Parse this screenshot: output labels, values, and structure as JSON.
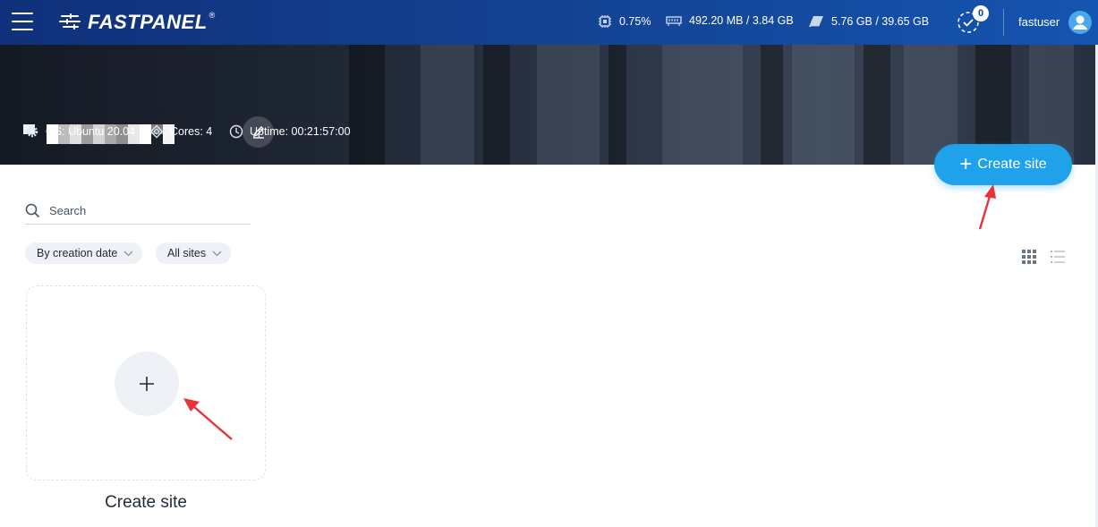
{
  "header": {
    "app_name": "FASTPANEL",
    "reg_mark": "®",
    "cpu_usage": "0.75%",
    "memory": "492.20 MB / 3.84 GB",
    "disk": "5.76 GB / 39.65 GB",
    "notifications_count": "0",
    "username": "fastuser"
  },
  "server": {
    "os": "OS: Ubuntu 20.04",
    "cores": "Cores: 4",
    "uptime": "Uptime: 00:21:57:00"
  },
  "actions": {
    "create_site_label": "Create site"
  },
  "search": {
    "placeholder": "Search"
  },
  "filters": {
    "sort": "By creation date",
    "scope": "All sites"
  },
  "card": {
    "label": "Create site"
  },
  "colors": {
    "accent": "#1fa2ea",
    "header": "#13408f",
    "annotation_arrow": "#e8333a"
  }
}
